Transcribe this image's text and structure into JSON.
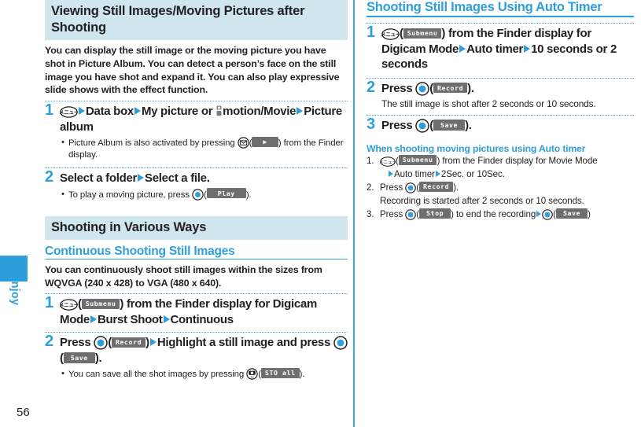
{
  "page": {
    "number": "56",
    "tab_label": "Enjoy",
    "accent_blue": "#2e9fda",
    "band_cyan": "#cfe6ee",
    "softkey_gray": "#6e6e70"
  },
  "left_column": {
    "heading": "Viewing Still Images/Moving Pictures after Shooting",
    "intro": "You can display the still image or the moving picture you have shot in Picture Album. You can detect a person’s face on the still image you have shot and expand it. You can also play expressive slide shows with the effect function.",
    "steps": [
      {
        "num": "1",
        "icon": "menu-key-icon",
        "parts": [
          "Data box",
          "My picture or",
          "motion/Movie",
          "Picture album"
        ],
        "bullet": "Picture Album is also activated by pressing",
        "bullet_icon": "mail-key-icon",
        "bullet_softkey": "play-arrow",
        "bullet_tail": "from the Finder display."
      },
      {
        "num": "2",
        "parts": [
          "Select a folder",
          "Select a file."
        ],
        "bullet_lead": "To play a moving picture, press",
        "bullet_icon": "center-key-icon",
        "bullet_softkey": "Play",
        "bullet_tail": ")."
      }
    ],
    "section2": {
      "heading": "Shooting in Various Ways",
      "subheading": "Continuous Shooting Still Images",
      "intro": "You can continuously shoot still images within the sizes from WQVGA (240 x 428) to VGA (480 x 640).",
      "steps": [
        {
          "num": "1",
          "icon": "menu-key-icon",
          "softkey": "Submenu",
          "lead": ") from the Finder display for Digicam Mode",
          "parts": [
            "Burst Shoot",
            "Continuous"
          ]
        },
        {
          "num": "2",
          "lead": "Press",
          "icon": "center-key-icon",
          "softkey": "Record",
          "mid": "Highlight a still image and press",
          "icon2": "center-key-icon",
          "softkey2": "Save",
          "tail": ").",
          "bullet_lead": "You can save all the shot images by pressing",
          "bullet_icon": "camera-tv-key-icon",
          "bullet_softkey": "STO all",
          "bullet_tail": ")."
        }
      ]
    }
  },
  "right_column": {
    "heading": "Shooting Still Images Using Auto Timer",
    "steps": [
      {
        "num": "1",
        "icon": "menu-key-icon",
        "softkey": "Submenu",
        "lead": ") from the Finder display for Digicam Mode",
        "parts": [
          "Auto timer",
          "10 seconds or 2 seconds"
        ]
      },
      {
        "num": "2",
        "lead": "Press",
        "icon": "center-key-icon",
        "softkey": "Record",
        "tail": ").",
        "note": "The still image is shot after 2 seconds or 10 seconds."
      },
      {
        "num": "3",
        "lead": "Press",
        "icon": "center-key-icon",
        "softkey": "Save",
        "tail": ")."
      }
    ],
    "note_block": {
      "title": "When shooting moving pictures using Auto timer",
      "items": [
        {
          "idx": "1.",
          "icon": "menu-key-icon",
          "softkey": "Submenu",
          "text": ") from the Finder display for Movie Mode",
          "cont_parts": [
            "Auto timer",
            "2Sec. or 10Sec."
          ]
        },
        {
          "idx": "2.",
          "lead": "Press",
          "icon": "center-key-icon",
          "softkey": "Record",
          "tail": ").",
          "cont": "Recording is started after 2 seconds or 10 seconds."
        },
        {
          "idx": "3.",
          "lead": "Press",
          "icon": "center-key-icon",
          "softkey": "Stop",
          "mid": ") to end the recording",
          "icon2": "center-key-icon",
          "softkey2": "Save",
          "tail": ")"
        }
      ]
    }
  }
}
